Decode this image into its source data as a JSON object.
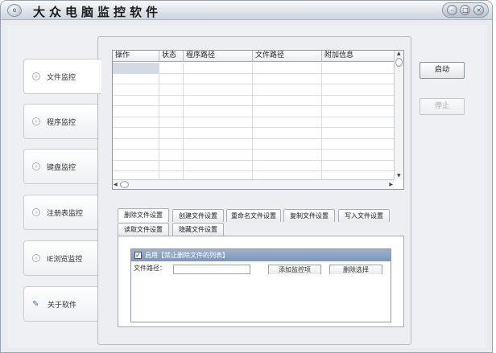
{
  "window": {
    "title": "大众电脑监控软件",
    "app_icon_glyph": "e",
    "controls": [
      "–",
      "□",
      "×"
    ]
  },
  "sidebar": {
    "items": [
      {
        "label": "文件监控",
        "icon": "radio-icon",
        "active": true
      },
      {
        "label": "程序监控",
        "icon": "radio-icon"
      },
      {
        "label": "键盘监控",
        "icon": "radio-icon"
      },
      {
        "label": "注册表监控",
        "icon": "radio-icon"
      },
      {
        "label": "IE浏览监控",
        "icon": "radio-icon"
      },
      {
        "label": "关于软件",
        "icon": "about-icon"
      }
    ]
  },
  "table": {
    "columns": [
      "操作",
      "状态",
      "程序路径",
      "文件路径",
      "附加信息"
    ],
    "rows": 15
  },
  "buttons": {
    "start": "启动",
    "stop": "停止"
  },
  "subtabs": {
    "row1": [
      "删除文件设置",
      "创建文件设置",
      "重命名文件设置",
      "复制文件设置",
      "写入文件设置"
    ],
    "row2": [
      "读取文件设置",
      "隐藏文件设置"
    ]
  },
  "settings": {
    "enable_label": "启用【禁止删除文件的列表】",
    "checked": true,
    "path_label": "文件路径：",
    "add_button": "添加监控项",
    "delete_button": "删除选择"
  },
  "colors": {
    "group_header": "#8a9fc1",
    "window_bg": "#e9ebef"
  }
}
